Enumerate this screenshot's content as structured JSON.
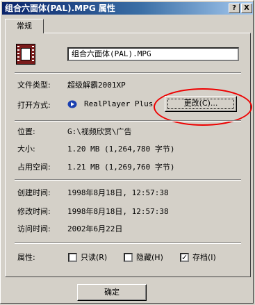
{
  "window": {
    "title": "组合六面体(PAL).MPG 属性",
    "help_label": "?",
    "close_label": "X"
  },
  "tabs": [
    {
      "label": "常规"
    }
  ],
  "general": {
    "file_name": "组合六面体(PAL).MPG",
    "file_type_label": "文件类型:",
    "file_type_value": "超级解霸2001XP",
    "open_with_label": "打开方式:",
    "open_with_value": "RealPlayer Plus",
    "change_button": "更改(C)...",
    "location_label": "位置:",
    "location_value": "G:\\视频欣赏\\广告",
    "size_label": "大小:",
    "size_value": "1.20 MB (1,264,780 字节)",
    "size_on_disk_label": "占用空间:",
    "size_on_disk_value": "1.21 MB (1,269,760 字节)",
    "created_label": "创建时间:",
    "created_value": "1998年8月18日, 12:57:38",
    "modified_label": "修改时间:",
    "modified_value": "1998年8月18日, 12:57:38",
    "accessed_label": "访问时间:",
    "accessed_value": "2002年6月22日",
    "attributes_label": "属性:",
    "attributes": [
      {
        "label": "只读(R)",
        "checked": false
      },
      {
        "label": "隐藏(H)",
        "checked": false
      },
      {
        "label": "存档(I)",
        "checked": true
      }
    ]
  },
  "footer": {
    "ok_button": "确定"
  },
  "colors": {
    "annotation_oval": "#ee0000",
    "title_bar": "#0a246a"
  },
  "icons": [
    "film-file-icon",
    "realplayer-icon"
  ]
}
